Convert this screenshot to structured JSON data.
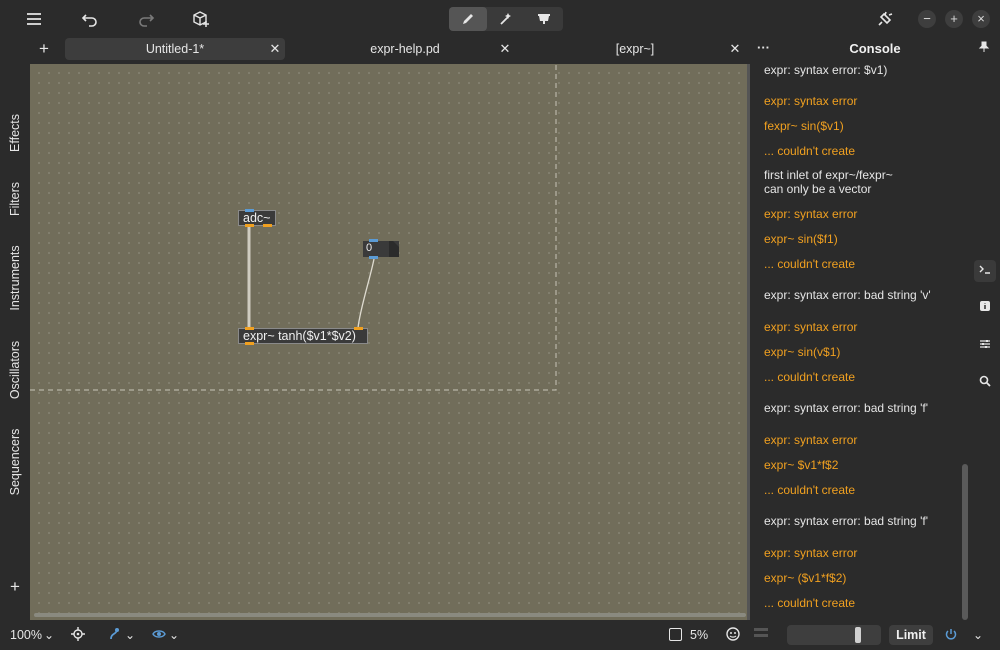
{
  "app": {
    "accent": "#f0a020",
    "canvas_color": "#716d5a"
  },
  "toolbar": {
    "menu_icon": "hamburger-menu-icon",
    "undo_icon": "undo-icon",
    "redo_icon": "redo-icon",
    "add_object_icon": "add-object-icon",
    "modes": [
      "edit-mode-pencil-icon",
      "run-mode-wand-icon",
      "presentation-mode-icon"
    ],
    "plugin_icon": "plugin-icon",
    "window_buttons": [
      "−",
      "+",
      "×"
    ]
  },
  "tabs": [
    {
      "label": "Untitled-1*",
      "active": true
    },
    {
      "label": "expr-help.pd",
      "active": false
    },
    {
      "label": "[expr~]",
      "active": false
    }
  ],
  "tab_add_label": "+",
  "sidebar": {
    "items": [
      "Effects",
      "Filters",
      "Instruments",
      "Oscillators",
      "Sequencers"
    ],
    "add_label": "+"
  },
  "patch": {
    "objects": {
      "adc": "adc~",
      "expr": "expr~ tanh($v1*$v2)",
      "number": "0"
    }
  },
  "console": {
    "title": "Console",
    "more_label": "···",
    "messages": [
      {
        "text": "expr: syntax error: $v1)",
        "type": "info"
      },
      {
        "text": "expr: syntax error",
        "type": "err"
      },
      {
        "text": "fexpr~ sin($v1)",
        "type": "err"
      },
      {
        "text": "... couldn't create",
        "type": "err"
      },
      {
        "text": "first inlet of expr~/fexpr~\ncan only be a vector",
        "type": "info"
      },
      {
        "text": "expr: syntax error",
        "type": "err"
      },
      {
        "text": "expr~ sin($f1)",
        "type": "err"
      },
      {
        "text": "... couldn't create",
        "type": "err"
      },
      {
        "text": "expr: syntax error: bad string 'v'",
        "type": "info"
      },
      {
        "text": "expr: syntax error",
        "type": "err"
      },
      {
        "text": "expr~ sin(v$1)",
        "type": "err"
      },
      {
        "text": "... couldn't create",
        "type": "err"
      },
      {
        "text": "expr: syntax error: bad string 'f'",
        "type": "info"
      },
      {
        "text": "expr: syntax error",
        "type": "err"
      },
      {
        "text": "expr~ $v1*f$2",
        "type": "err"
      },
      {
        "text": "... couldn't create",
        "type": "err"
      },
      {
        "text": "expr: syntax error: bad string 'f'",
        "type": "info"
      },
      {
        "text": "expr: syntax error",
        "type": "err"
      },
      {
        "text": "expr~ ($v1*f$2)",
        "type": "err"
      },
      {
        "text": "... couldn't create",
        "type": "err"
      }
    ]
  },
  "rightbar": {
    "icons": [
      "console-icon",
      "info-icon",
      "sliders-icon",
      "search-icon"
    ]
  },
  "status": {
    "zoom": "100%",
    "cpu": "5%",
    "limit_label": "Limit",
    "volume_level": 0.78
  }
}
